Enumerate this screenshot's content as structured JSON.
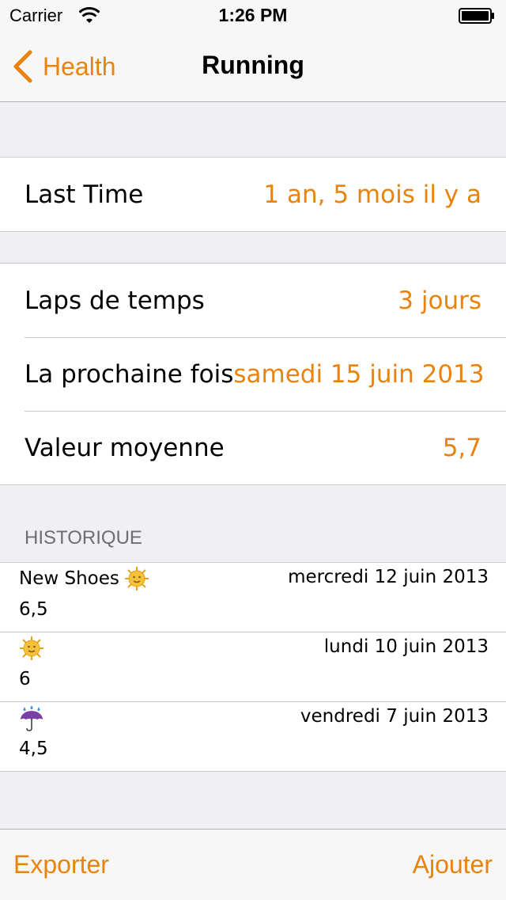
{
  "status_bar": {
    "carrier": "Carrier",
    "time": "1:26 PM"
  },
  "nav": {
    "back_label": "Health",
    "title": "Running"
  },
  "summary": {
    "last_time_label": "Last Time",
    "last_time_value": "1 an, 5 mois il y a"
  },
  "stats": {
    "rows": [
      {
        "label": "Laps de temps",
        "value": "3 jours"
      },
      {
        "label": "La prochaine fois",
        "value": "samedi 15 juin 2013"
      },
      {
        "label": "Valeur moyenne",
        "value": "5,7"
      }
    ]
  },
  "history": {
    "header": "HISTORIQUE",
    "entries": [
      {
        "note": "New Shoes",
        "icon": "sun-face-icon",
        "date": "mercredi 12 juin 2013",
        "value": "6,5"
      },
      {
        "note": "",
        "icon": "sun-face-icon",
        "date": "lundi 10 juin 2013",
        "value": "6"
      },
      {
        "note": "",
        "icon": "umbrella-rain-icon",
        "date": "vendredi 7 juin 2013",
        "value": "4,5"
      }
    ]
  },
  "toolbar": {
    "export_label": "Exporter",
    "add_label": "Ajouter"
  },
  "colors": {
    "accent": "#e9830d",
    "background": "#efeff4",
    "separator": "#c8c7cc"
  }
}
